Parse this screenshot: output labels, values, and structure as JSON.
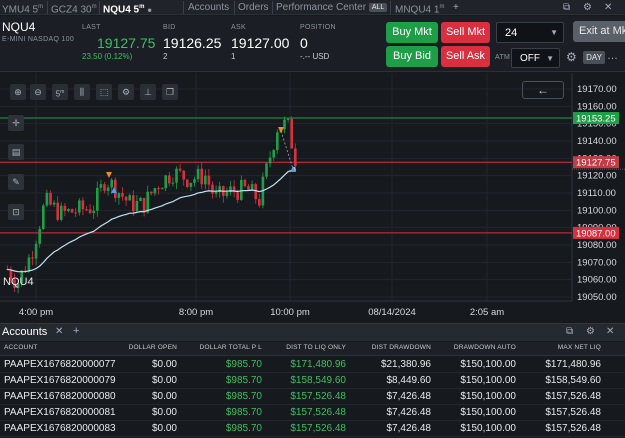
{
  "tabs": [
    {
      "label": "YMU4 5",
      "sup": "m",
      "active": false
    },
    {
      "label": "GCZ4 30",
      "sup": "m",
      "active": false
    },
    {
      "label": "NQU4 5",
      "sup": "m",
      "active": true
    },
    {
      "label": "Accounts",
      "active": false
    },
    {
      "label": "Orders",
      "active": false
    },
    {
      "label": "Performance Center",
      "badge": "ALL",
      "active": false
    },
    {
      "label": "MNQU4 1",
      "sup": "m",
      "active": false
    }
  ],
  "quote": {
    "symbol": "NQU4",
    "description": "E-MINI NASDAQ 100",
    "last_label": "LAST",
    "last": "19127.75",
    "change": "23.50 (0.12%)",
    "bid_label": "BID",
    "bid": "19126.25",
    "bid_size": "2",
    "ask_label": "ASK",
    "ask": "19127.00",
    "ask_size": "1",
    "position_label": "POSITION",
    "position": "0",
    "position_sub": "-.-- USD"
  },
  "order_panel": {
    "buy_mkt": "Buy Mkt",
    "sell_mkt": "Sell Mkt",
    "buy_bid": "Buy Bid",
    "sell_ask": "Sell Ask",
    "quantity": "24",
    "atm_label": "ATM",
    "atm_value": "OFF",
    "day_label": "DAY",
    "exit_label": "Exit at Mk"
  },
  "chart": {
    "symbol_label": "NQU4",
    "price_ticks": [
      "19170.00",
      "19160.00",
      "19150.00",
      "19140.00",
      "19130.00",
      "19120.00",
      "19110.00",
      "19100.00",
      "19090.00",
      "19080.00",
      "19070.00",
      "19060.00",
      "19050.00"
    ],
    "time_ticks": [
      "4:00 pm",
      "8:00 pm",
      "10:00 pm",
      "08/14/2024",
      "2:05 am"
    ],
    "green_line_label": "19153.25",
    "last_price_label": "19127.75",
    "red_line_label": "19087.00",
    "colors": {
      "up": "#1e9e47",
      "down": "#d9303f",
      "ma": "#bfe3f2"
    }
  },
  "accounts": {
    "title": "Accounts",
    "columns": [
      "ACCOUNT",
      "DOLLAR OPEN",
      "DOLLAR TOTAL P L",
      "DIST TO LIQ ONLY",
      "DIST DRAWDOWN",
      "DRAWDOWN AUTO",
      "MAX NET LIQ"
    ],
    "rows": [
      [
        "PAAPEX1676820000077",
        "$0.00",
        "$985.70",
        "$171,480.96",
        "$21,380.96",
        "$150,100.00",
        "$171,480.96"
      ],
      [
        "PAAPEX1676820000079",
        "$0.00",
        "$985.70",
        "$158,549.60",
        "$8,449.60",
        "$150,100.00",
        "$158,549.60"
      ],
      [
        "PAAPEX1676820000080",
        "$0.00",
        "$985.70",
        "$157,526.48",
        "$7,426.48",
        "$150,100.00",
        "$157,526.48"
      ],
      [
        "PAAPEX1676820000081",
        "$0.00",
        "$985.70",
        "$157,526.48",
        "$7,426.48",
        "$150,100.00",
        "$157,526.48"
      ],
      [
        "PAAPEX1676820000083",
        "$0.00",
        "$985.70",
        "$157,526.48",
        "$7,426.48",
        "$150,100.00",
        "$157,526.48"
      ]
    ]
  }
}
